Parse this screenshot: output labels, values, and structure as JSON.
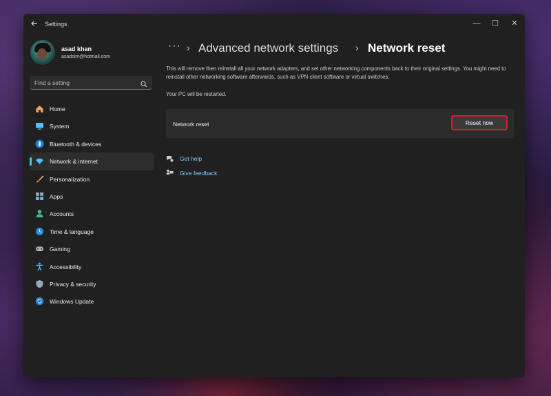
{
  "window": {
    "title": "Settings",
    "controls": {
      "minimize": "—",
      "maximize": "☐",
      "close": "✕"
    }
  },
  "profile": {
    "name": "asad khan",
    "email": "asadsim@hotmail.com"
  },
  "search": {
    "placeholder": "Find a setting"
  },
  "sidebar": {
    "items": [
      {
        "label": "Home",
        "icon": "home-icon"
      },
      {
        "label": "System",
        "icon": "system-icon"
      },
      {
        "label": "Bluetooth & devices",
        "icon": "bluetooth-icon"
      },
      {
        "label": "Network & internet",
        "icon": "wifi-icon",
        "active": true
      },
      {
        "label": "Personalization",
        "icon": "brush-icon"
      },
      {
        "label": "Apps",
        "icon": "apps-icon"
      },
      {
        "label": "Accounts",
        "icon": "accounts-icon"
      },
      {
        "label": "Time & language",
        "icon": "globe-icon"
      },
      {
        "label": "Gaming",
        "icon": "gamepad-icon"
      },
      {
        "label": "Accessibility",
        "icon": "accessibility-icon"
      },
      {
        "label": "Privacy & security",
        "icon": "shield-icon"
      },
      {
        "label": "Windows Update",
        "icon": "update-icon"
      }
    ]
  },
  "breadcrumb": {
    "overflow": "···",
    "separator": "›",
    "parent": "Advanced network settings",
    "current": "Network reset"
  },
  "main": {
    "description": "This will remove then reinstall all your network adapters, and set other networking components back to their original settings. You might need to reinstall other networking software afterwards, such as VPN client software or virtual switches.",
    "restart_note": "Your PC will be restarted.",
    "card": {
      "label": "Network reset",
      "button": "Reset now"
    },
    "links": {
      "help": "Get help",
      "feedback": "Give feedback"
    }
  },
  "colors": {
    "accent": "#4cc2ff",
    "link": "#7ccfff",
    "highlight_border": "#e0182a",
    "window_bg": "#202020",
    "card_bg": "#2b2b2b"
  }
}
